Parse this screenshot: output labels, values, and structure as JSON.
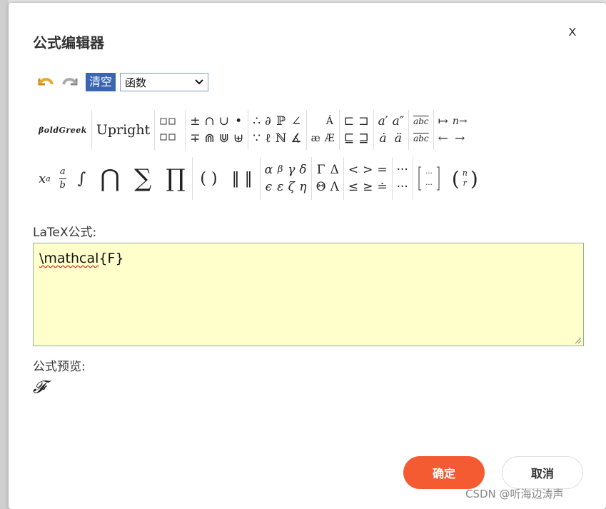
{
  "dialog": {
    "title": "公式编辑器",
    "close_label": "X"
  },
  "toolbar": {
    "undo_icon": "undo-icon",
    "redo_icon": "redo-icon",
    "clear_label": "清空",
    "category_select": "函数"
  },
  "symbols": {
    "bold_greek": "βoldGreek",
    "upright": "Upright",
    "ops_top": [
      "±",
      "∩",
      "∪",
      "•"
    ],
    "ops_bottom": [
      "∓",
      "⋒",
      "⋓",
      "⊎"
    ],
    "logic_top": [
      "∴",
      "∂",
      "ℙ",
      "∠"
    ],
    "logic_bottom": [
      "∵",
      "ℓ",
      "ℕ",
      "∡"
    ],
    "accents_ae": "æ",
    "accents_AE": "Æ",
    "accents_A_top": "Á",
    "set_top": [
      "⊏",
      "⊐"
    ],
    "set_bottom": [
      "⊑",
      "⊒"
    ],
    "prime_top": [
      "a′",
      "a″"
    ],
    "prime_bottom": [
      "ȧ",
      "ä"
    ],
    "abc_top": "abc",
    "abc_bottom": "abc",
    "arrows_top": [
      "↦",
      "n→"
    ],
    "arrows_bottom": [
      "←",
      "→"
    ],
    "power": "x",
    "power_sup": "a",
    "frac_num": "a",
    "frac_den": "b",
    "integral": "∫",
    "bigcap": "⋂",
    "sum": "∑",
    "prod": "∏",
    "paren": "( )",
    "norm": "‖ ‖",
    "greek_top": [
      "α",
      "β",
      "γ",
      "δ"
    ],
    "greek_bottom": [
      "ϵ",
      "ε",
      "ζ",
      "η"
    ],
    "Greek_top": [
      "Γ",
      "Δ"
    ],
    "Greek_bottom": [
      "Θ",
      "Λ"
    ],
    "rel_top": [
      "<",
      ">",
      "="
    ],
    "rel_bottom": [
      "≤",
      "≥",
      "≐"
    ],
    "dots_top": "···",
    "dots_bottom": "···",
    "matrix": "[···]",
    "binom_n": "n",
    "binom_r": "r"
  },
  "latex": {
    "label": "LaTeX公式:",
    "value_cmd": "\\mathcal",
    "value_rest": "{F}"
  },
  "preview": {
    "label": "公式预览:",
    "rendered": "𝓕"
  },
  "buttons": {
    "ok": "确定",
    "cancel": "取消"
  },
  "watermark": "CSDN @听海边涛声"
}
